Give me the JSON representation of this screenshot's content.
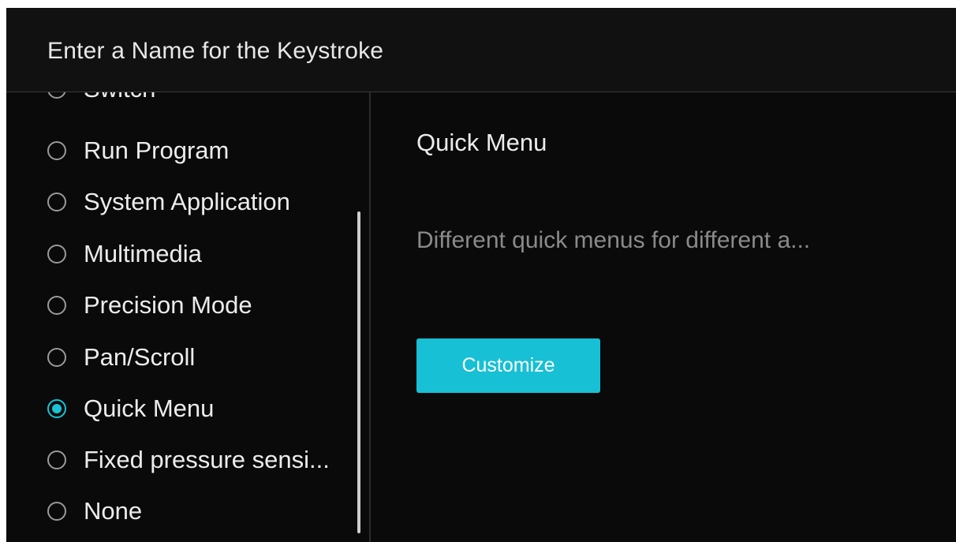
{
  "dialog": {
    "title": "Enter a Name for the Keystroke"
  },
  "options": {
    "partial_label": "Switch",
    "items": [
      {
        "label": "Run Program",
        "checked": false
      },
      {
        "label": "System Application",
        "checked": false
      },
      {
        "label": "Multimedia",
        "checked": false
      },
      {
        "label": "Precision Mode",
        "checked": false
      },
      {
        "label": "Pan/Scroll",
        "checked": false
      },
      {
        "label": "Quick Menu",
        "checked": true
      },
      {
        "label": "Fixed pressure sensi...",
        "checked": false
      },
      {
        "label": "None",
        "checked": false
      }
    ]
  },
  "detail": {
    "title": "Quick Menu",
    "description": "Different quick menus for different a...",
    "button_label": "Customize"
  },
  "colors": {
    "accent": "#17c0d4",
    "background": "#0a0a0a",
    "header_background": "#111111",
    "text": "#ececec",
    "muted_text": "#8a8a8a"
  }
}
